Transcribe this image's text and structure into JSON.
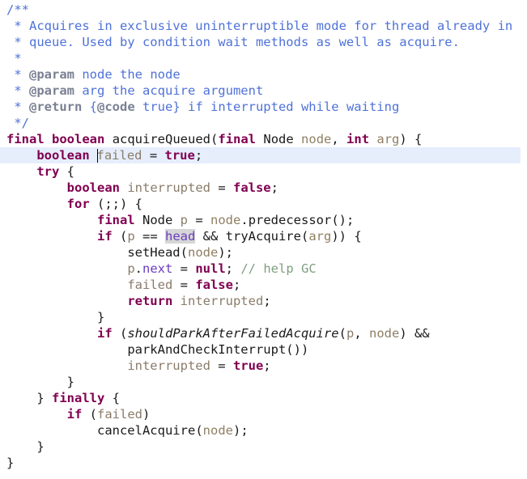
{
  "editor": {
    "language": "java",
    "theme": "intellij-light",
    "background_color": "#ffffff",
    "current_line_highlight_color": "#e6eefc",
    "occurrence_highlight_color": "#d6d6d6",
    "caret_color": "#000000",
    "colors": {
      "keyword": "#800050",
      "identifier": "#1a1a1a",
      "parameter": "#8f7f63",
      "local_variable": "#8a7c6a",
      "field": "#6a3ec0",
      "line_comment": "#7f9f7f",
      "javadoc": "#4f72d8",
      "javadoc_tag": "#7a8193"
    },
    "caret_line_index": 9,
    "highlighted_token": "head"
  },
  "code": {
    "plain_text": "/**\n * Acquires in exclusive uninterruptible mode for thread already in\n * queue. Used by condition wait methods as well as acquire.\n *\n * @param node the node\n * @param arg the acquire argument\n * @return {@code true} if interrupted while waiting\n */\nfinal boolean acquireQueued(final Node node, int arg) {\n    boolean failed = true;\n    try {\n        boolean interrupted = false;\n        for (;;) {\n            final Node p = node.predecessor();\n            if (p == head && tryAcquire(arg)) {\n                setHead(node);\n                p.next = null; // help GC\n                failed = false;\n                return interrupted;\n            }\n            if (shouldParkAfterFailedAcquire(p, node) &&\n                parkAndCheckInterrupt())\n                interrupted = true;\n        }\n    } finally {\n        if (failed)\n            cancelAcquire(node);\n    }\n}",
    "lines": [
      {
        "index": 0,
        "indent": 0,
        "current": false,
        "tokens": [
          {
            "t": "doc",
            "v": "/**"
          }
        ]
      },
      {
        "index": 1,
        "indent": 0,
        "current": false,
        "tokens": [
          {
            "t": "doc",
            "v": " * Acquires in exclusive uninterruptible mode for thread already in"
          }
        ]
      },
      {
        "index": 2,
        "indent": 0,
        "current": false,
        "tokens": [
          {
            "t": "doc",
            "v": " * queue. Used by condition wait methods as well as acquire."
          }
        ]
      },
      {
        "index": 3,
        "indent": 0,
        "current": false,
        "tokens": [
          {
            "t": "doc",
            "v": " *"
          }
        ]
      },
      {
        "index": 4,
        "indent": 0,
        "current": false,
        "tokens": [
          {
            "t": "doc",
            "v": " * "
          },
          {
            "t": "doctag",
            "v": "@param"
          },
          {
            "t": "doc",
            "v": " node the node"
          }
        ]
      },
      {
        "index": 5,
        "indent": 0,
        "current": false,
        "tokens": [
          {
            "t": "doc",
            "v": " * "
          },
          {
            "t": "doctag",
            "v": "@param"
          },
          {
            "t": "doc",
            "v": " arg the acquire argument"
          }
        ]
      },
      {
        "index": 6,
        "indent": 0,
        "current": false,
        "tokens": [
          {
            "t": "doc",
            "v": " * "
          },
          {
            "t": "doctag",
            "v": "@return"
          },
          {
            "t": "doc",
            "v": " {"
          },
          {
            "t": "doctag",
            "v": "@code"
          },
          {
            "t": "doc",
            "v": " true} if interrupted while waiting"
          }
        ]
      },
      {
        "index": 7,
        "indent": 0,
        "current": false,
        "tokens": [
          {
            "t": "doc",
            "v": " */"
          }
        ]
      },
      {
        "index": 8,
        "indent": 0,
        "current": false,
        "tokens": [
          {
            "t": "kw",
            "v": "final"
          },
          {
            "t": "plain",
            "v": " "
          },
          {
            "t": "kw",
            "v": "boolean"
          },
          {
            "t": "plain",
            "v": " "
          },
          {
            "t": "method",
            "v": "acquireQueued"
          },
          {
            "t": "punc",
            "v": "("
          },
          {
            "t": "kw",
            "v": "final"
          },
          {
            "t": "plain",
            "v": " "
          },
          {
            "t": "type",
            "v": "Node"
          },
          {
            "t": "plain",
            "v": " "
          },
          {
            "t": "param",
            "v": "node"
          },
          {
            "t": "punc",
            "v": ", "
          },
          {
            "t": "kw",
            "v": "int"
          },
          {
            "t": "plain",
            "v": " "
          },
          {
            "t": "param",
            "v": "arg"
          },
          {
            "t": "punc",
            "v": ") {"
          }
        ]
      },
      {
        "index": 9,
        "indent": 4,
        "current": true,
        "tokens": [
          {
            "t": "kw",
            "v": "boolean"
          },
          {
            "t": "plain",
            "v": " "
          },
          {
            "t": "caret",
            "v": ""
          },
          {
            "t": "local",
            "v": "failed"
          },
          {
            "t": "punc",
            "v": " = "
          },
          {
            "t": "kw",
            "v": "true"
          },
          {
            "t": "punc",
            "v": ";"
          }
        ]
      },
      {
        "index": 10,
        "indent": 4,
        "current": false,
        "tokens": [
          {
            "t": "kw",
            "v": "try"
          },
          {
            "t": "punc",
            "v": " {"
          }
        ]
      },
      {
        "index": 11,
        "indent": 8,
        "current": false,
        "tokens": [
          {
            "t": "kw",
            "v": "boolean"
          },
          {
            "t": "plain",
            "v": " "
          },
          {
            "t": "local",
            "v": "interrupted"
          },
          {
            "t": "punc",
            "v": " = "
          },
          {
            "t": "kw",
            "v": "false"
          },
          {
            "t": "punc",
            "v": ";"
          }
        ]
      },
      {
        "index": 12,
        "indent": 8,
        "current": false,
        "tokens": [
          {
            "t": "kw",
            "v": "for"
          },
          {
            "t": "punc",
            "v": " (;;) {"
          }
        ]
      },
      {
        "index": 13,
        "indent": 12,
        "current": false,
        "tokens": [
          {
            "t": "kw",
            "v": "final"
          },
          {
            "t": "plain",
            "v": " "
          },
          {
            "t": "type",
            "v": "Node"
          },
          {
            "t": "plain",
            "v": " "
          },
          {
            "t": "local",
            "v": "p"
          },
          {
            "t": "punc",
            "v": " = "
          },
          {
            "t": "param",
            "v": "node"
          },
          {
            "t": "punc",
            "v": "."
          },
          {
            "t": "method",
            "v": "predecessor"
          },
          {
            "t": "punc",
            "v": "();"
          }
        ]
      },
      {
        "index": 14,
        "indent": 12,
        "current": false,
        "tokens": [
          {
            "t": "kw",
            "v": "if"
          },
          {
            "t": "punc",
            "v": " ("
          },
          {
            "t": "local",
            "v": "p"
          },
          {
            "t": "punc",
            "v": " == "
          },
          {
            "t": "field-hl",
            "v": "head"
          },
          {
            "t": "punc",
            "v": " && "
          },
          {
            "t": "method",
            "v": "tryAcquire"
          },
          {
            "t": "punc",
            "v": "("
          },
          {
            "t": "param",
            "v": "arg"
          },
          {
            "t": "punc",
            "v": ")) {"
          }
        ]
      },
      {
        "index": 15,
        "indent": 16,
        "current": false,
        "tokens": [
          {
            "t": "method",
            "v": "setHead"
          },
          {
            "t": "punc",
            "v": "("
          },
          {
            "t": "param",
            "v": "node"
          },
          {
            "t": "punc",
            "v": ");"
          }
        ]
      },
      {
        "index": 16,
        "indent": 16,
        "current": false,
        "tokens": [
          {
            "t": "local",
            "v": "p"
          },
          {
            "t": "punc",
            "v": "."
          },
          {
            "t": "field",
            "v": "next"
          },
          {
            "t": "punc",
            "v": " = "
          },
          {
            "t": "kw",
            "v": "null"
          },
          {
            "t": "punc",
            "v": "; "
          },
          {
            "t": "linecmt",
            "v": "// help GC"
          }
        ]
      },
      {
        "index": 17,
        "indent": 16,
        "current": false,
        "tokens": [
          {
            "t": "local",
            "v": "failed"
          },
          {
            "t": "punc",
            "v": " = "
          },
          {
            "t": "kw",
            "v": "false"
          },
          {
            "t": "punc",
            "v": ";"
          }
        ]
      },
      {
        "index": 18,
        "indent": 16,
        "current": false,
        "tokens": [
          {
            "t": "kw",
            "v": "return"
          },
          {
            "t": "plain",
            "v": " "
          },
          {
            "t": "local",
            "v": "interrupted"
          },
          {
            "t": "punc",
            "v": ";"
          }
        ]
      },
      {
        "index": 19,
        "indent": 12,
        "current": false,
        "tokens": [
          {
            "t": "punc",
            "v": "}"
          }
        ]
      },
      {
        "index": 20,
        "indent": 12,
        "current": false,
        "tokens": [
          {
            "t": "kw",
            "v": "if"
          },
          {
            "t": "punc",
            "v": " ("
          },
          {
            "t": "method-i",
            "v": "shouldParkAfterFailedAcquire"
          },
          {
            "t": "punc",
            "v": "("
          },
          {
            "t": "local",
            "v": "p"
          },
          {
            "t": "punc",
            "v": ", "
          },
          {
            "t": "param",
            "v": "node"
          },
          {
            "t": "punc",
            "v": ") &&"
          }
        ]
      },
      {
        "index": 21,
        "indent": 16,
        "current": false,
        "tokens": [
          {
            "t": "method",
            "v": "parkAndCheckInterrupt"
          },
          {
            "t": "punc",
            "v": "())"
          }
        ]
      },
      {
        "index": 22,
        "indent": 16,
        "current": false,
        "tokens": [
          {
            "t": "local",
            "v": "interrupted"
          },
          {
            "t": "punc",
            "v": " = "
          },
          {
            "t": "kw",
            "v": "true"
          },
          {
            "t": "punc",
            "v": ";"
          }
        ]
      },
      {
        "index": 23,
        "indent": 8,
        "current": false,
        "tokens": [
          {
            "t": "punc",
            "v": "}"
          }
        ]
      },
      {
        "index": 24,
        "indent": 4,
        "current": false,
        "tokens": [
          {
            "t": "punc",
            "v": "} "
          },
          {
            "t": "kw",
            "v": "finally"
          },
          {
            "t": "punc",
            "v": " {"
          }
        ]
      },
      {
        "index": 25,
        "indent": 8,
        "current": false,
        "tokens": [
          {
            "t": "kw",
            "v": "if"
          },
          {
            "t": "punc",
            "v": " ("
          },
          {
            "t": "local",
            "v": "failed"
          },
          {
            "t": "punc",
            "v": ")"
          }
        ]
      },
      {
        "index": 26,
        "indent": 12,
        "current": false,
        "tokens": [
          {
            "t": "method",
            "v": "cancelAcquire"
          },
          {
            "t": "punc",
            "v": "("
          },
          {
            "t": "param",
            "v": "node"
          },
          {
            "t": "punc",
            "v": ");"
          }
        ]
      },
      {
        "index": 27,
        "indent": 4,
        "current": false,
        "tokens": [
          {
            "t": "punc",
            "v": "}"
          }
        ]
      },
      {
        "index": 28,
        "indent": 0,
        "current": false,
        "tokens": [
          {
            "t": "punc",
            "v": "}"
          }
        ]
      }
    ]
  }
}
